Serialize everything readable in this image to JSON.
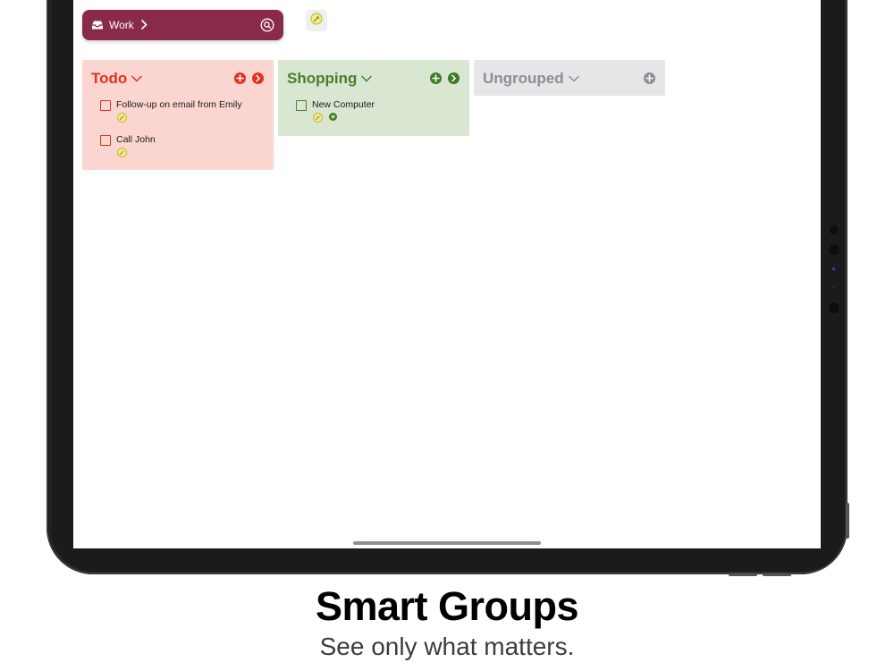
{
  "header": {
    "context_label": "Work",
    "context_icon": "tray-icon",
    "search_icon": "search-icon",
    "tag_icon": "tag-icon"
  },
  "groups": [
    {
      "id": "todo",
      "title": "Todo",
      "color": "#e0331c",
      "background": "#fbd5d0",
      "actions": [
        "add-icon",
        "chevron-right-icon"
      ],
      "tasks": [
        {
          "title": "Follow-up on email from Emily",
          "badges": [
            "tag-icon"
          ]
        },
        {
          "title": "Call John",
          "badges": [
            "tag-icon"
          ]
        }
      ]
    },
    {
      "id": "shopping",
      "title": "Shopping",
      "color": "#4b7d2c",
      "background": "#d8e6d2",
      "actions": [
        "add-icon",
        "chevron-right-icon"
      ],
      "tasks": [
        {
          "title": "New Computer",
          "badges": [
            "tag-icon",
            "list-icon"
          ]
        }
      ]
    },
    {
      "id": "ungrouped",
      "title": "Ungrouped",
      "color": "#8e8e93",
      "background": "#e6e6e8",
      "actions": [
        "add-icon"
      ],
      "tasks": []
    }
  ],
  "caption": {
    "title": "Smart Groups",
    "subtitle": "See only what matters."
  },
  "colors": {
    "context_pill": "#8a2a4b",
    "tag_badge": "#d6cc3a"
  }
}
